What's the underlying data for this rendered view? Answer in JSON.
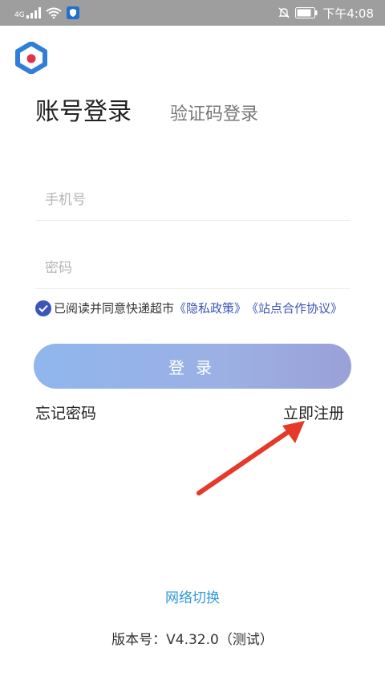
{
  "status_bar": {
    "network_label": "4G",
    "time": "下午4:08",
    "icons": [
      "signal-icon",
      "wifi-icon",
      "shield-app-icon",
      "mute-bell-icon",
      "battery-icon"
    ]
  },
  "colors": {
    "status_bar_bg": "#9e9e9e",
    "accent": "#3d55b8",
    "link_blue": "#2f9ad8",
    "logo_blue": "#2f7fd8",
    "logo_red": "#e0324b",
    "arrow_red": "#e53a2a"
  },
  "tabs": {
    "account_login": "账号登录",
    "code_login": "验证码登录"
  },
  "form": {
    "phone_placeholder": "手机号",
    "phone_value": "",
    "password_placeholder": "密码",
    "password_value": ""
  },
  "agreement": {
    "checked": true,
    "text": "已阅读并同意快递超市",
    "privacy_link": "《隐私政策》",
    "site_link": "《站点合作协议》"
  },
  "buttons": {
    "login": "登录"
  },
  "links": {
    "forgot_password": "忘记密码",
    "register": "立即注册",
    "network_switch": "网络切换"
  },
  "footer": {
    "version": "版本号：V4.32.0（测试）"
  }
}
